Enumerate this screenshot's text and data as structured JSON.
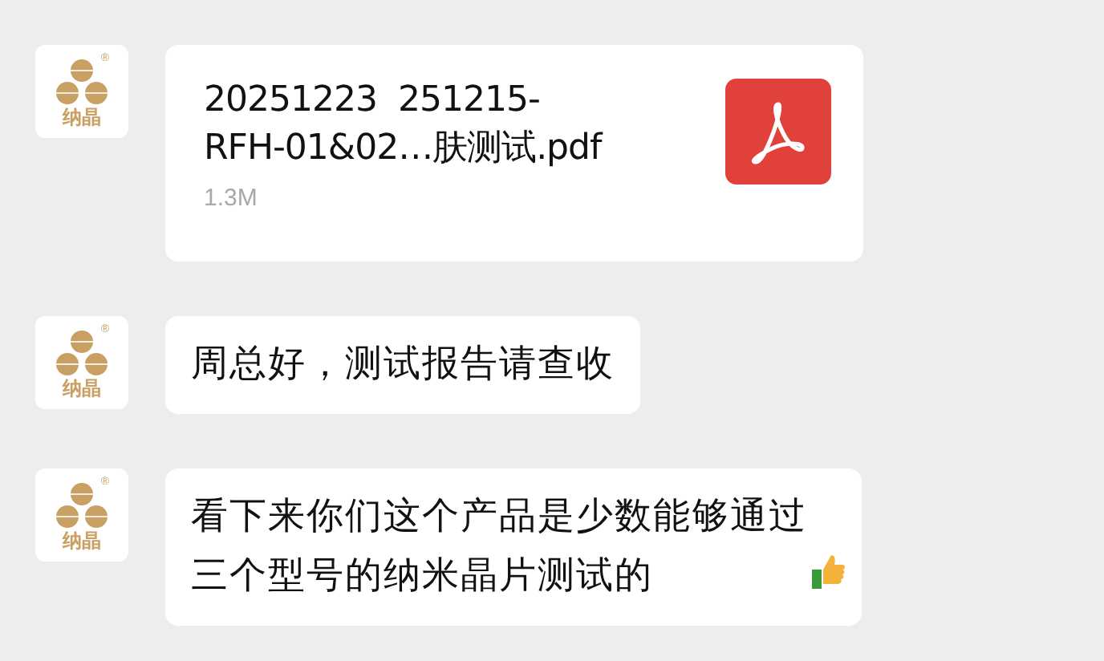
{
  "messages": [
    {
      "kind": "file",
      "avatar": {
        "text": "纳晶",
        "mark": "®"
      },
      "file_name_lines": [
        "20251223  251215-",
        "RFH-01&02…肤测试.pdf"
      ],
      "file_size": "1.3M"
    },
    {
      "kind": "text",
      "avatar": {
        "text": "纳晶",
        "mark": "®"
      },
      "lines": [
        "周总好，测试报告请查收"
      ],
      "thumbs_up": false
    },
    {
      "kind": "text",
      "avatar": {
        "text": "纳晶",
        "mark": "®"
      },
      "lines": [
        "看下来你们这个产品是少数能够通过",
        "三个型号的纳米晶片测试的"
      ],
      "thumbs_up": true
    }
  ]
}
